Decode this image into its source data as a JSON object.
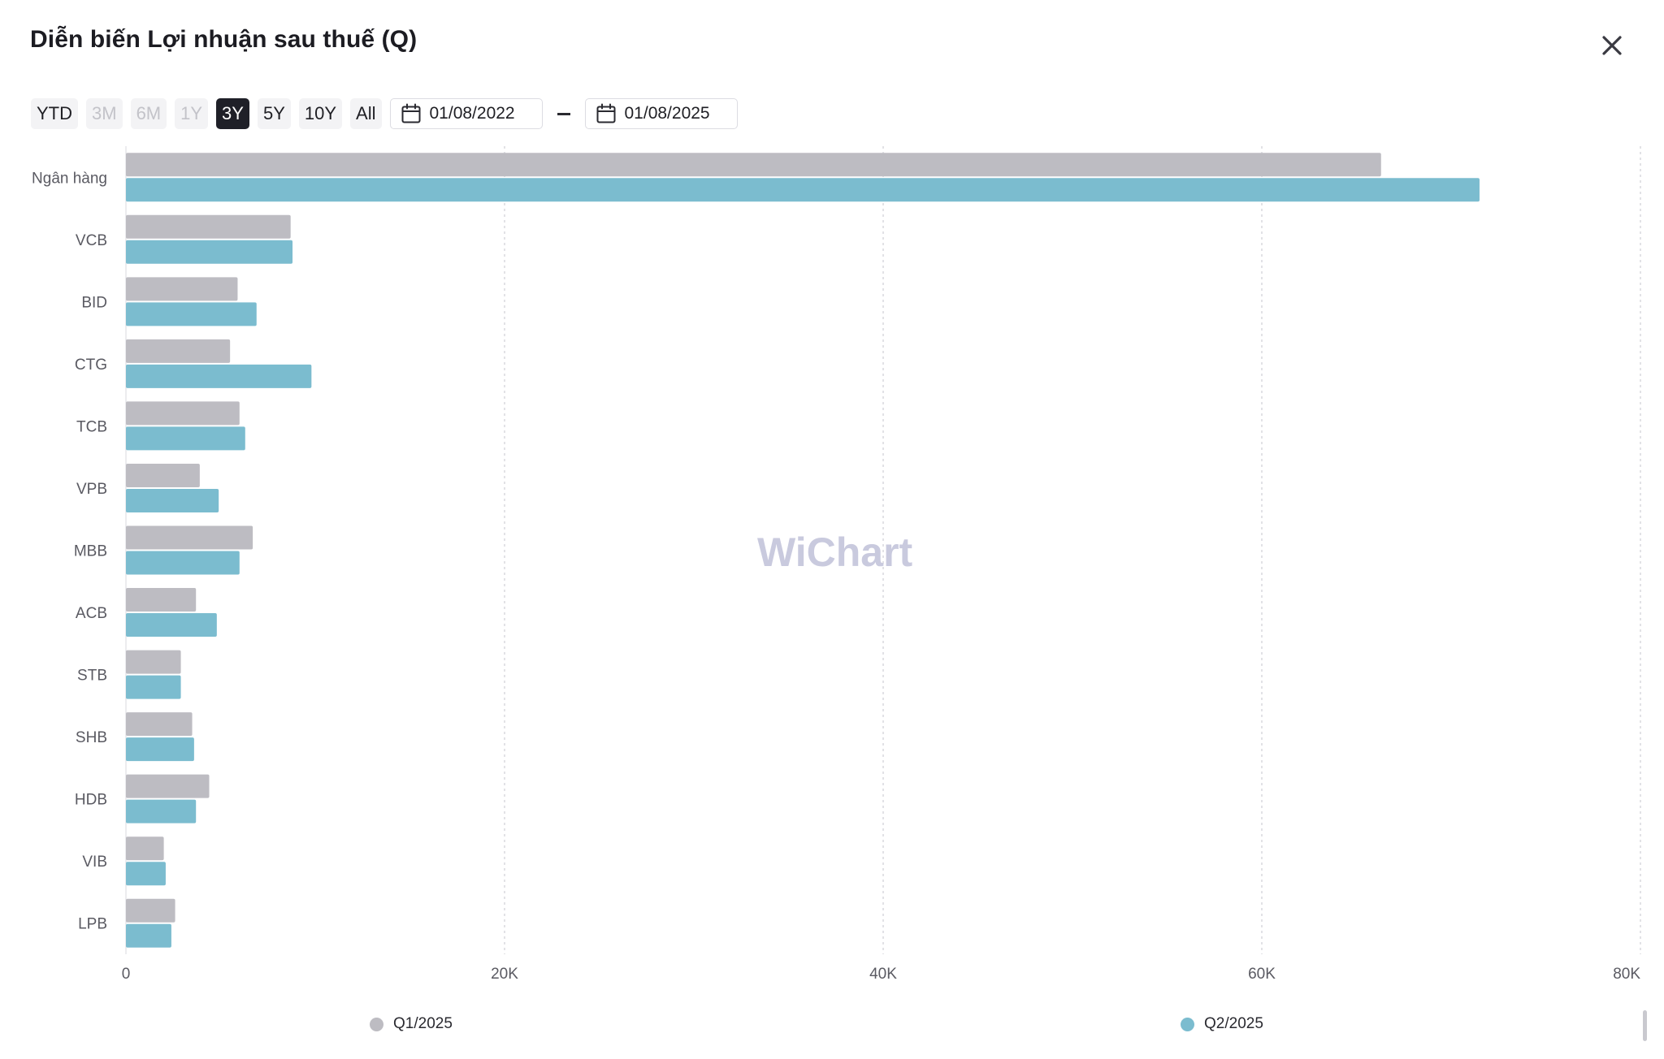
{
  "modal": {
    "title": "Diễn biến Lợi nhuận sau thuế (Q)",
    "close_icon": "close-icon"
  },
  "toolbar": {
    "ranges": [
      {
        "label": "YTD",
        "state": "normal"
      },
      {
        "label": "3M",
        "state": "disabled"
      },
      {
        "label": "6M",
        "state": "disabled"
      },
      {
        "label": "1Y",
        "state": "disabled"
      },
      {
        "label": "3Y",
        "state": "active"
      },
      {
        "label": "5Y",
        "state": "normal"
      },
      {
        "label": "10Y",
        "state": "normal"
      },
      {
        "label": "All",
        "state": "normal"
      }
    ],
    "date_from": "01/08/2022",
    "date_to": "01/08/2025",
    "calendar_icon": "calendar-icon"
  },
  "watermark": "WiChart",
  "colors": {
    "q1": "#bdbcc2",
    "q2": "#7bbccf",
    "active_range": "#1f2028"
  },
  "chart_data": {
    "type": "bar",
    "orientation": "horizontal",
    "categories": [
      "Ngân hàng",
      "VCB",
      "BID",
      "CTG",
      "TCB",
      "VPB",
      "MBB",
      "ACB",
      "STB",
      "SHB",
      "HDB",
      "VIB",
      "LPB"
    ],
    "series": [
      {
        "name": "Q1/2025",
        "color": "#bdbcc2",
        "values": [
          66300,
          8700,
          5900,
          5500,
          6000,
          3900,
          6700,
          3700,
          2900,
          3500,
          4400,
          2000,
          2600
        ]
      },
      {
        "name": "Q2/2025",
        "color": "#7bbccf",
        "values": [
          71500,
          8800,
          6900,
          9800,
          6300,
          4900,
          6000,
          4800,
          2900,
          3600,
          3700,
          2100,
          2400
        ]
      }
    ],
    "xaxis": {
      "min": 0,
      "max": 80000,
      "ticks": [
        0,
        20000,
        40000,
        60000,
        80000
      ],
      "tick_labels": [
        "0",
        "20K",
        "40K",
        "60K",
        "80K"
      ]
    },
    "grid": "vertical dotted",
    "legend": "bottom"
  }
}
